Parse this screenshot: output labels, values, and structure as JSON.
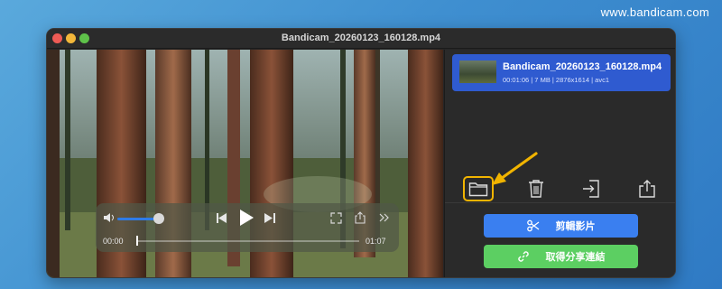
{
  "watermark": "www.bandicam.com",
  "window": {
    "title": "Bandicam_20260123_160128.mp4"
  },
  "player": {
    "time_current": "00:00",
    "time_total": "01:07",
    "volume_level": 0.8,
    "progress_fraction": 0.0
  },
  "file_list": [
    {
      "name": "Bandicam_20260123_160128.mp4",
      "meta": "00:01:06 | 7 MB | 2876x1614 | avc1",
      "selected": true
    }
  ],
  "toolbar": {
    "icons": [
      "folder-icon",
      "trash-icon",
      "import-icon",
      "share-icon"
    ]
  },
  "actions": {
    "edit_label": "剪輯影片",
    "share_link_label": "取得分享連結"
  },
  "colors": {
    "accent_blue": "#3a7ff0",
    "accent_green": "#5ccf62",
    "selection": "#2f5bd0",
    "highlight": "#f1b400"
  }
}
